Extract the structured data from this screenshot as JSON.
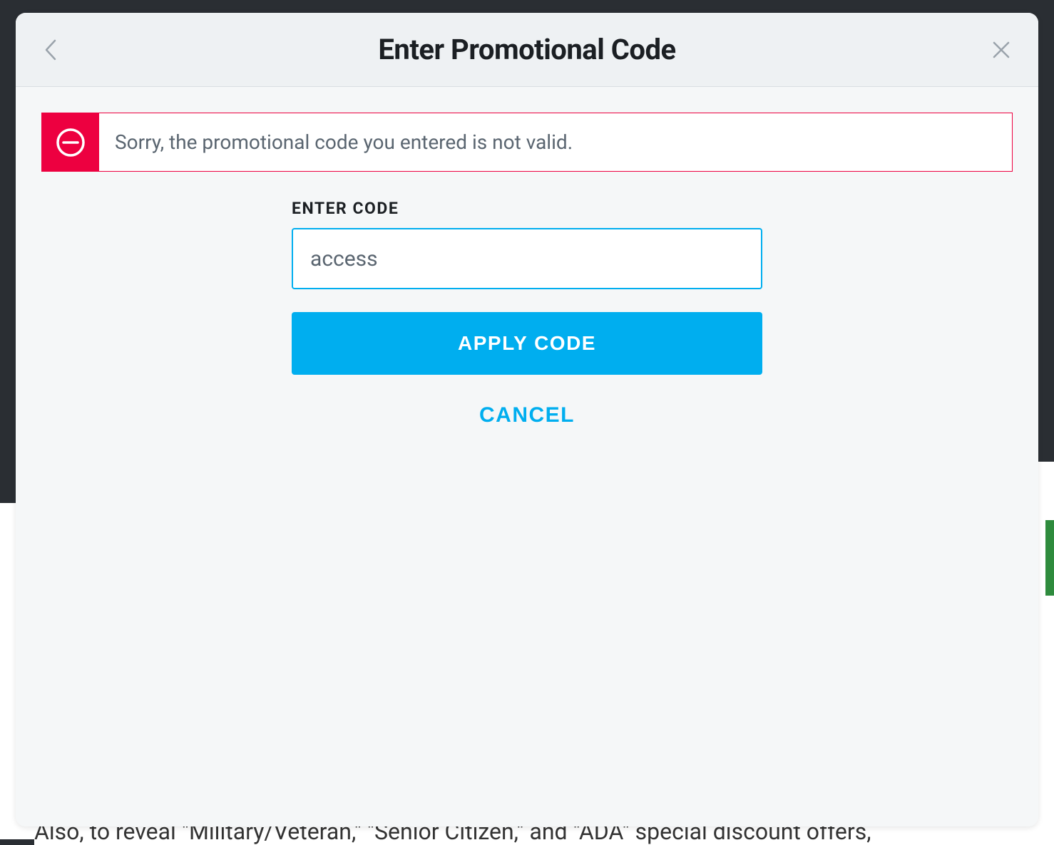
{
  "modal": {
    "title": "Enter Promotional Code",
    "error_message": "Sorry, the promotional code you entered is not valid.",
    "input_label": "ENTER CODE",
    "input_value": "access",
    "apply_label": "APPLY CODE",
    "cancel_label": "CANCEL"
  },
  "background": {
    "partial_text": "Also, to reveal \"Military/Veteran,\" \"Senior Citizen,\" and \"ADA\" special discount offers,"
  },
  "colors": {
    "error_red": "#ed0040",
    "primary_blue": "#00aeef",
    "text_dark": "#1b1f23",
    "text_muted": "#5a6570"
  }
}
